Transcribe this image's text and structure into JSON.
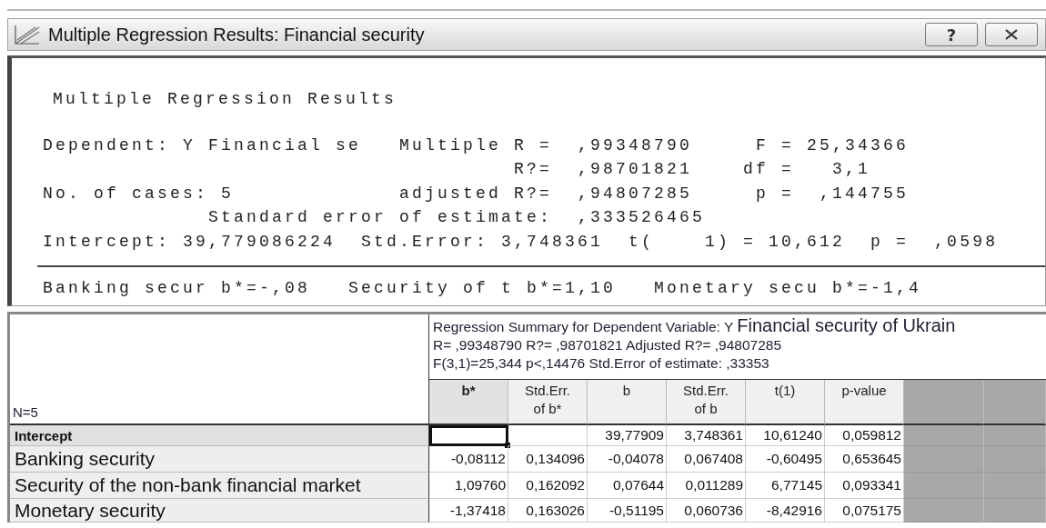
{
  "window": {
    "title": "Multiple Regression Results: Financial security",
    "help_button": "?"
  },
  "results": {
    "heading": "Multiple Regression Results",
    "lines": [
      "Dependent: Y Financial se   Multiple R =  ,99348790     F = 25,34366",
      "                                     R?=  ,98701821    df =   3,1",
      "No. of cases: 5             adjusted R?=  ,94807285     p =  ,144755",
      "             Standard error of estimate:  ,333526465",
      "Intercept: 39,779086224  Std.Error: 3,748361  t(    1) = 10,612  p =  ,0598"
    ],
    "coefficients_line": "Banking secur b*=-,08   Security of t b*=1,10   Monetary secu b*=-1,4"
  },
  "sheet": {
    "corner_label": "N=5",
    "summary": {
      "title": "Regression Summary for Dependent Variable: Y",
      "dependent": "Financial security of Ukrain",
      "line_2": "R= ,99348790 R?= ,98701821 Adjusted R?= ,94807285",
      "line_3": "F(3,1)=25,344 p<,14476 Std.Error of estimate: ,33353"
    },
    "columns": [
      {
        "label": "b*",
        "selected": true
      },
      {
        "label": "Std.Err.\nof b*",
        "selected": false
      },
      {
        "label": "b",
        "selected": false
      },
      {
        "label": "Std.Err.\nof b",
        "selected": false
      },
      {
        "label": "t(1)",
        "selected": false
      },
      {
        "label": "p-value",
        "selected": false
      }
    ],
    "rows": [
      {
        "label": "Intercept",
        "kind": "constant",
        "cells": [
          {
            "selected": true
          },
          {
            "selected": false
          },
          {
            "text": "39,77909",
            "selected": false
          },
          {
            "text": "3,748361",
            "selected": false
          },
          {
            "text": "10,61240",
            "selected": false
          },
          {
            "text": "0,059812",
            "selected": false
          }
        ]
      },
      {
        "label": "Banking security",
        "kind": "predictor",
        "cells": [
          {
            "text": "-0,08112",
            "selected": false
          },
          {
            "text": "0,134096",
            "selected": false
          },
          {
            "text": "-0,04078",
            "selected": false
          },
          {
            "text": "0,067408",
            "selected": false
          },
          {
            "text": "-0,60495",
            "selected": false
          },
          {
            "text": "0,653645",
            "selected": false
          }
        ]
      },
      {
        "label": "Security of the non-bank financial market",
        "kind": "predictor",
        "cells": [
          {
            "text": "1,09760",
            "selected": false
          },
          {
            "text": "0,162092",
            "selected": false
          },
          {
            "text": "0,07644",
            "selected": false
          },
          {
            "text": "0,011289",
            "selected": false
          },
          {
            "text": "6,77145",
            "selected": false
          },
          {
            "text": "0,093341",
            "selected": false
          }
        ]
      },
      {
        "label": "Monetary security",
        "kind": "predictor",
        "cells": [
          {
            "text": "-1,37418",
            "selected": false
          },
          {
            "text": "0,163026",
            "selected": false
          },
          {
            "text": "-0,51195",
            "selected": false
          },
          {
            "text": "0,060736",
            "selected": false
          },
          {
            "text": "-8,42916",
            "selected": false
          },
          {
            "text": "0,075175",
            "selected": false
          }
        ]
      }
    ]
  }
}
